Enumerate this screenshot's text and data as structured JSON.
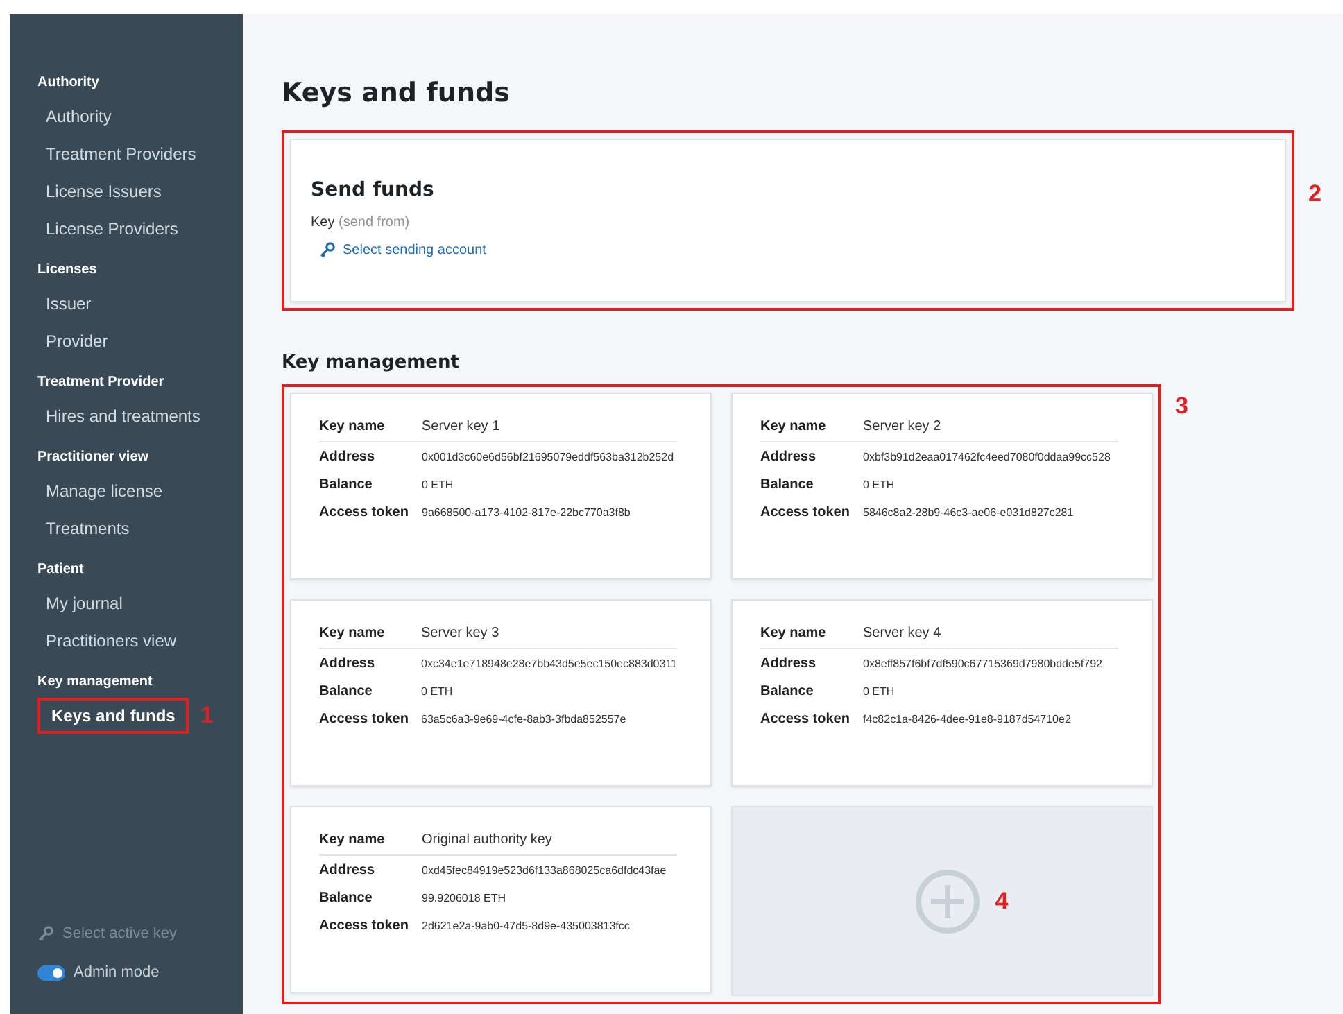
{
  "sidebar": {
    "sections": [
      {
        "heading": "Authority",
        "items": [
          {
            "label": "Authority",
            "selected": false
          },
          {
            "label": "Treatment Providers",
            "selected": false
          },
          {
            "label": "License Issuers",
            "selected": false
          },
          {
            "label": "License Providers",
            "selected": false
          }
        ]
      },
      {
        "heading": "Licenses",
        "items": [
          {
            "label": "Issuer",
            "selected": false
          },
          {
            "label": "Provider",
            "selected": false
          }
        ]
      },
      {
        "heading": "Treatment Provider",
        "items": [
          {
            "label": "Hires and treatments",
            "selected": false
          }
        ]
      },
      {
        "heading": "Practitioner view",
        "items": [
          {
            "label": "Manage license",
            "selected": false
          },
          {
            "label": "Treatments",
            "selected": false
          }
        ]
      },
      {
        "heading": "Patient",
        "items": [
          {
            "label": "My journal",
            "selected": false
          },
          {
            "label": "Practitioners view",
            "selected": false
          }
        ]
      },
      {
        "heading": "Key management",
        "items": [
          {
            "label": "Keys and funds",
            "selected": true,
            "annotation": "1"
          }
        ]
      }
    ],
    "select_key": {
      "label": "Select active key"
    },
    "admin_mode": {
      "label": "Admin mode",
      "on": true
    }
  },
  "page_title": "Keys and funds",
  "send_funds": {
    "annotation": "2",
    "title": "Send funds",
    "key_label": "Key",
    "key_hint": "(send from)",
    "action": "Select sending account"
  },
  "key_management": {
    "title": "Key management",
    "annotation": "3",
    "keys": [
      {
        "fields": [
          {
            "label": "Key name",
            "value": "Server key 1"
          },
          {
            "label": "Address",
            "value": "0x001d3c60e6d56bf21695079eddf563ba312b252d"
          },
          {
            "label": "Balance",
            "value": "0 ETH"
          },
          {
            "label": "Access token",
            "value": "9a668500-a173-4102-817e-22bc770a3f8b"
          }
        ]
      },
      {
        "fields": [
          {
            "label": "Key name",
            "value": "Server key 2"
          },
          {
            "label": "Address",
            "value": "0xbf3b91d2eaa017462fc4eed7080f0ddaa99cc528"
          },
          {
            "label": "Balance",
            "value": "0 ETH"
          },
          {
            "label": "Access token",
            "value": "5846c8a2-28b9-46c3-ae06-e031d827c281"
          }
        ]
      },
      {
        "fields": [
          {
            "label": "Key name",
            "value": "Server key 3"
          },
          {
            "label": "Address",
            "value": "0xc34e1e718948e28e7bb43d5e5ec150ec883d0311"
          },
          {
            "label": "Balance",
            "value": "0 ETH"
          },
          {
            "label": "Access token",
            "value": "63a5c6a3-9e69-4cfe-8ab3-3fbda852557e"
          }
        ]
      },
      {
        "fields": [
          {
            "label": "Key name",
            "value": "Server key 4"
          },
          {
            "label": "Address",
            "value": "0x8eff857f6bf7df590c67715369d7980bdde5f792"
          },
          {
            "label": "Balance",
            "value": "0 ETH"
          },
          {
            "label": "Access token",
            "value": "f4c82c1a-8426-4dee-91e8-9187d54710e2"
          }
        ]
      },
      {
        "fields": [
          {
            "label": "Key name",
            "value": "Original authority key"
          },
          {
            "label": "Address",
            "value": "0xd45fec84919e523d6f133a868025ca6dfdc43fae"
          },
          {
            "label": "Balance",
            "value": "99.9206018 ETH"
          },
          {
            "label": "Access token",
            "value": "2d621e2a-9ab0-47d5-8d9e-435003813fcc"
          }
        ]
      }
    ],
    "add_card": {
      "annotation": "4"
    }
  }
}
